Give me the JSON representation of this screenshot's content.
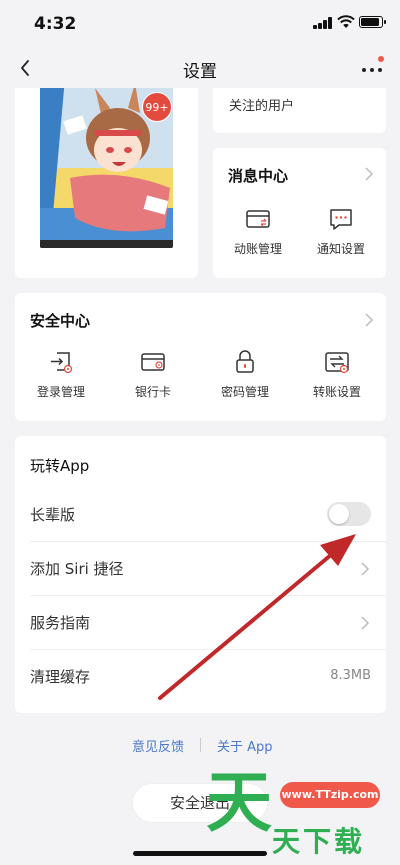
{
  "status_bar": {
    "time": "4:32"
  },
  "nav": {
    "title": "设置"
  },
  "avatar_card": {
    "badge_count": "99+"
  },
  "follow_card": {
    "label": "关注的用户"
  },
  "message_center": {
    "title": "消息中心",
    "items": [
      {
        "label": "动账管理",
        "icon": "card-transfer-icon"
      },
      {
        "label": "通知设置",
        "icon": "chat-bubble-icon"
      }
    ]
  },
  "security_center": {
    "title": "安全中心",
    "items": [
      {
        "label": "登录管理",
        "icon": "login-icon"
      },
      {
        "label": "银行卡",
        "icon": "bank-card-icon"
      },
      {
        "label": "密码管理",
        "icon": "lock-icon"
      },
      {
        "label": "转账设置",
        "icon": "transfer-icon"
      }
    ]
  },
  "play_app": {
    "title": "玩转App",
    "rows": [
      {
        "label": "长辈版",
        "control": "toggle",
        "toggle_on": false
      },
      {
        "label": "添加 Siri 捷径",
        "control": "chevron"
      },
      {
        "label": "服务指南",
        "control": "chevron"
      },
      {
        "label": "清理缓存",
        "value": "8.3MB"
      }
    ]
  },
  "footer_links": {
    "feedback": "意见反馈",
    "about": "关于 App"
  },
  "logout": {
    "label": "安全退出"
  },
  "watermark": {
    "url": "www.TTzip.com",
    "char": "天",
    "text": "天下载"
  },
  "colors": {
    "accent_red": "#e44b3f",
    "link_blue": "#4a79c9",
    "watermark_green": "#2fae52",
    "arrow_red": "#c0282a"
  }
}
